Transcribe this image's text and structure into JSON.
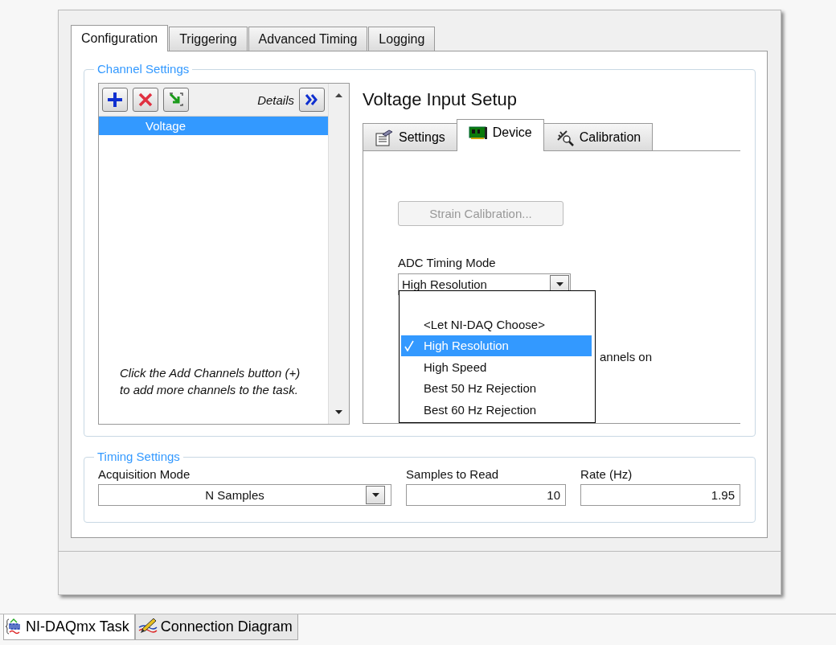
{
  "main_tabs": [
    {
      "label": "Configuration",
      "selected": true
    },
    {
      "label": "Triggering",
      "selected": false
    },
    {
      "label": "Advanced Timing",
      "selected": false
    },
    {
      "label": "Logging",
      "selected": false
    }
  ],
  "channel_settings": {
    "legend": "Channel Settings",
    "details_label": "Details",
    "channels": [
      {
        "name": "Voltage",
        "selected": true
      }
    ],
    "hint": "Click the Add Channels button (+) to add more channels to the task.",
    "setup_title": "Voltage Input Setup",
    "setup_tabs": [
      {
        "label": "Settings",
        "kind": "settings",
        "selected": false
      },
      {
        "label": "Device",
        "kind": "device",
        "selected": true
      },
      {
        "label": "Calibration",
        "kind": "calibration",
        "selected": false
      }
    ],
    "device": {
      "strain_button": {
        "label": "Strain Calibration...",
        "disabled": true
      },
      "adc_label": "ADC Timing Mode",
      "adc_value": "High Resolution",
      "menu": [
        {
          "label": "<Let NI-DAQ Choose>",
          "selected": false
        },
        {
          "label": "High Resolution",
          "selected": true
        },
        {
          "label": "High Speed",
          "selected": false
        },
        {
          "label": "Best 50 Hz Rejection",
          "selected": false
        },
        {
          "label": "Best 60 Hz Rejection",
          "selected": false
        }
      ],
      "covered_text": "annels on"
    }
  },
  "timing_settings": {
    "legend": "Timing Settings",
    "acquisition_mode": {
      "label": "Acquisition Mode",
      "value": "N Samples"
    },
    "samples_to_read": {
      "label": "Samples to Read",
      "value": "10"
    },
    "rate": {
      "label": "Rate (Hz)",
      "value": "1.95"
    }
  },
  "bottom_tabs": [
    {
      "label": "NI-DAQmx Task",
      "kind": "task",
      "selected": true
    },
    {
      "label": "Connection Diagram",
      "kind": "diagram",
      "selected": false
    }
  ]
}
